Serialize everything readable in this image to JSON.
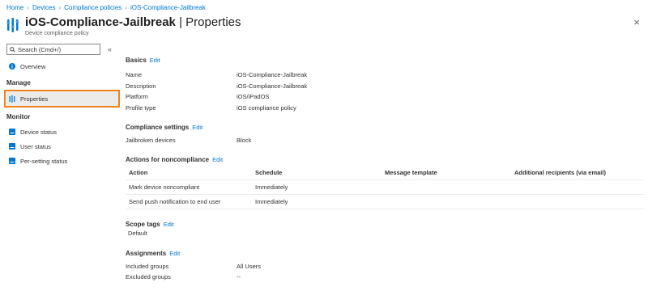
{
  "breadcrumb": [
    "Home",
    "Devices",
    "Compliance policies",
    "iOS-Compliance-Jailbreak"
  ],
  "header": {
    "policy_name": "iOS-Compliance-Jailbreak",
    "separator": "|",
    "page_name": "Properties",
    "subtitle": "Device compliance policy",
    "close": "×"
  },
  "sidebar": {
    "search_placeholder": "Search (Cmd+/)",
    "collapse": "«",
    "overview": "Overview",
    "manage_label": "Manage",
    "properties": "Properties",
    "monitor_label": "Monitor",
    "monitor_items": [
      "Device status",
      "User status",
      "Per-setting status"
    ]
  },
  "basics": {
    "title": "Basics",
    "edit": "Edit",
    "rows": [
      {
        "k": "Name",
        "v": "iOS-Compliance-Jailbreak"
      },
      {
        "k": "Description",
        "v": "iOS-Compliance-Jailbreak"
      },
      {
        "k": "Platform",
        "v": "iOS/iPadOS"
      },
      {
        "k": "Profile type",
        "v": "iOS compliance policy"
      }
    ]
  },
  "compliance": {
    "title": "Compliance settings",
    "edit": "Edit",
    "k": "Jailbroken devices",
    "v": "Block"
  },
  "actions": {
    "title": "Actions for noncompliance",
    "edit": "Edit",
    "headers": [
      "Action",
      "Schedule",
      "Message template",
      "Additional recipients (via email)"
    ],
    "rows": [
      [
        "Mark device noncompliant",
        "Immediately",
        "",
        ""
      ],
      [
        "Send push notification to end user",
        "Immediately",
        "",
        ""
      ]
    ]
  },
  "scope": {
    "title": "Scope tags",
    "edit": "Edit",
    "value": "Default"
  },
  "assignments": {
    "title": "Assignments",
    "edit": "Edit",
    "rows": [
      {
        "k": "Included groups",
        "v": "All Users"
      },
      {
        "k": "Excluded groups",
        "v": "--"
      }
    ]
  },
  "colors": {
    "accent": "#0078d4",
    "highlight": "#f0821e",
    "selected_bg": "#edebe9"
  }
}
